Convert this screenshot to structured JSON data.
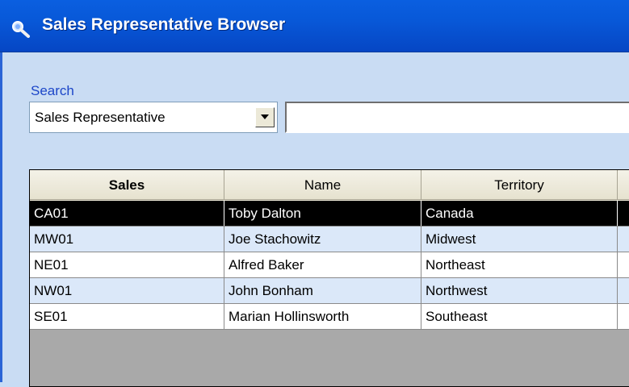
{
  "window": {
    "title": "Sales Representative Browser",
    "icon": "magnifier-icon"
  },
  "search": {
    "label": "Search",
    "field_selected": "Sales Representative",
    "query_value": ""
  },
  "table": {
    "columns": [
      "Sales",
      "Name",
      "Territory"
    ],
    "rows": [
      {
        "sales": "CA01",
        "name": "Toby Dalton",
        "territory": "Canada",
        "selected": true
      },
      {
        "sales": "MW01",
        "name": "Joe Stachowitz",
        "territory": "Midwest"
      },
      {
        "sales": "NE01",
        "name": "Alfred Baker",
        "territory": "Northeast"
      },
      {
        "sales": "NW01",
        "name": "John Bonham",
        "territory": "Northwest"
      },
      {
        "sales": "SE01",
        "name": "Marian Hollinsworth",
        "territory": "Southeast"
      }
    ]
  },
  "colors": {
    "titlebar": "#0858d8",
    "window_bg": "#c9dcf3",
    "selected_row": "#000000",
    "alt_row": "#dbe8f9",
    "grid_empty": "#a9a9a9"
  }
}
